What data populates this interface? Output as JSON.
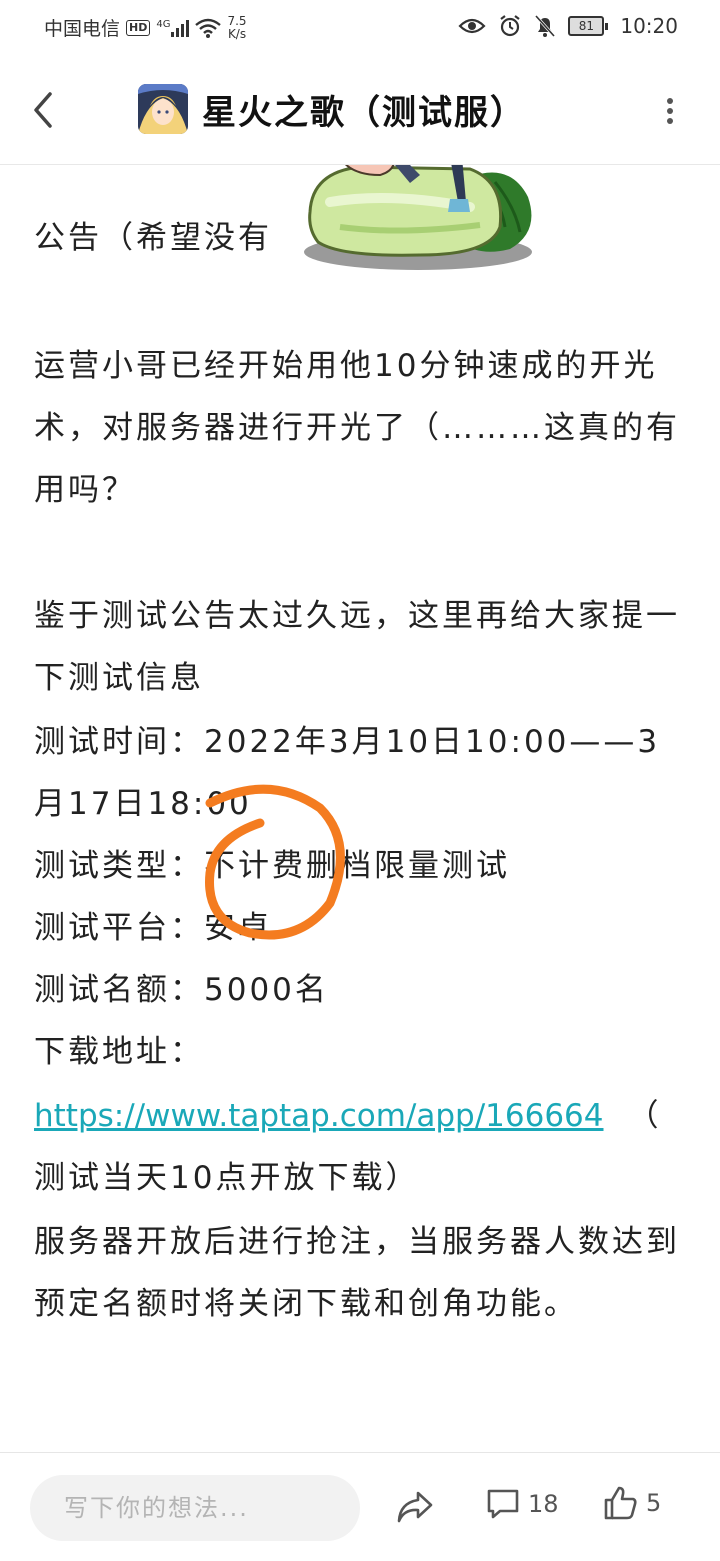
{
  "status_bar": {
    "carrier": "中国电信",
    "hd": "HD",
    "network": "4G",
    "speed_value": "7.5",
    "speed_unit": "K/s",
    "battery": "81",
    "time": "10:20"
  },
  "header": {
    "title": "星火之歌（测试服）"
  },
  "article": {
    "p_announce": "公告（希望没有",
    "p_ops": "运营小哥已经开始用他10分钟速成的开光术，对服务器进行开光了（………这真的有用吗？",
    "p_intro": "鉴于测试公告太过久远，这里再给大家提一下测试信息",
    "test_time": "测试时间：2022年3月10日10:00——3月17日18:00",
    "test_type": "测试类型：不计费删档限量测试",
    "test_platform": "测试平台：安卓",
    "test_quota": "测试名额：5000名",
    "download_label": "下载地址：",
    "download_url": "https://www.taptap.com/app/166664",
    "download_note_open": "（",
    "download_note": "测试当天10点开放下载）",
    "p_server": "服务器开放后进行抢注，当服务器人数达到预定名额时将关闭下载和创角功能。"
  },
  "bottom_bar": {
    "comment_placeholder": "写下你的想法...",
    "comment_count": "18",
    "like_count": "5"
  },
  "colors": {
    "link": "#1aa8b8",
    "annotation_circle": "#f47c20"
  }
}
